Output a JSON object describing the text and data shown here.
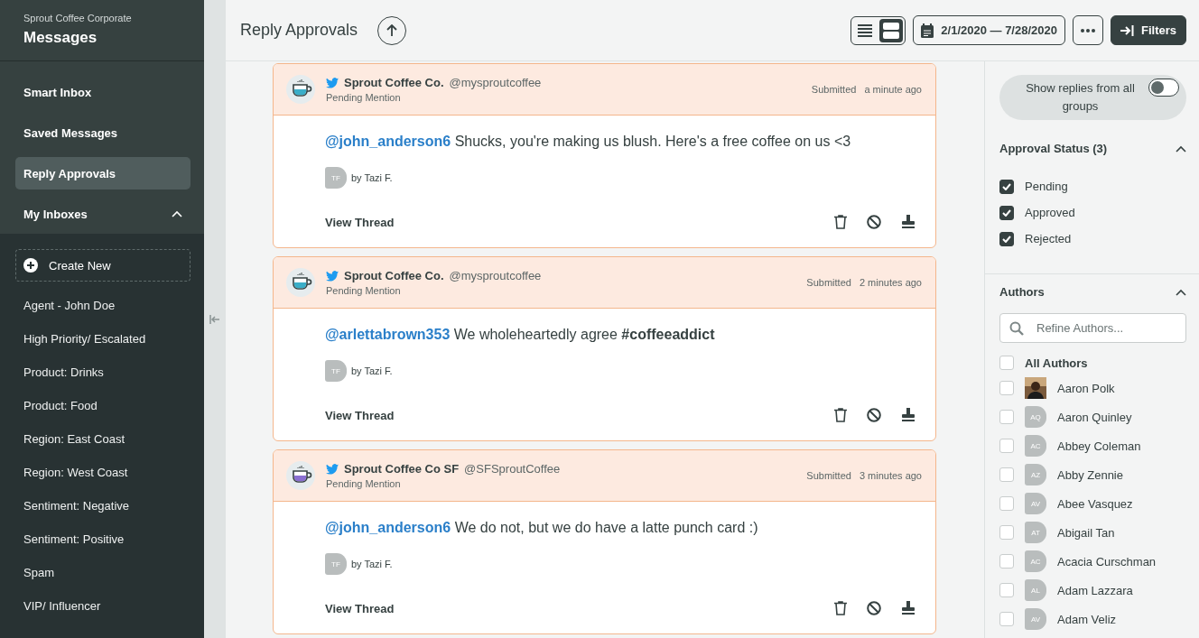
{
  "sidebar": {
    "org": "Sprout Coffee Corporate",
    "title": "Messages",
    "nav": [
      {
        "label": "Smart Inbox",
        "selected": false
      },
      {
        "label": "Saved Messages",
        "selected": false
      },
      {
        "label": "Reply Approvals",
        "selected": true
      }
    ],
    "my_inboxes": {
      "label": "My Inboxes",
      "expanded": true,
      "create_button": "Create New",
      "items": [
        "Agent - John Doe",
        "High Priority/ Escalated",
        "Product: Drinks",
        "Product: Food",
        "Region: East Coast",
        "Region: West Coast",
        "Sentiment: Negative",
        "Sentiment: Positive",
        "Spam",
        "VIP/ Influencer"
      ]
    }
  },
  "header": {
    "title": "Reply Approvals",
    "view_modes": [
      {
        "kind": "list",
        "selected": false
      },
      {
        "kind": "cards",
        "selected": true
      }
    ],
    "date_range": "2/1/2020 — 7/28/2020",
    "filters_button": "Filters"
  },
  "messages": [
    {
      "account": "Sprout Coffee Co.",
      "handle": "@mysproutcoffee",
      "status": "Pending Mention",
      "submitted_label": "Submitted",
      "time": "a minute ago",
      "color": "#3aaec8",
      "mention": "@john_anderson6",
      "text": "Shucks, you're making us blush. Here's a free coffee on us <3",
      "author_initials": "TF",
      "author": "by Tazi F.",
      "view_thread": "View Thread"
    },
    {
      "account": "Sprout Coffee Co.",
      "handle": "@mysproutcoffee",
      "status": "Pending Mention",
      "submitted_label": "Submitted",
      "time": "2 minutes ago",
      "color": "#3aaec8",
      "mention": "@arlettabrown353",
      "text": "We wholeheartedly agree **#coffeeaddict**",
      "author_initials": "TF",
      "author": "by Tazi F.",
      "view_thread": "View Thread"
    },
    {
      "account": "Sprout Coffee Co SF",
      "handle": "@SFSproutCoffee",
      "status": "Pending Mention",
      "submitted_label": "Submitted",
      "time": "3 minutes ago",
      "color": "#8a6fd1",
      "mention": "@john_anderson6",
      "text": "We do not, but we do have a latte punch card :)",
      "author_initials": "TF",
      "author": "by Tazi F.",
      "view_thread": "View Thread"
    }
  ],
  "filters": {
    "show_all_groups": {
      "label": "Show replies from all groups",
      "on": false
    },
    "approval_status": {
      "title": "Approval Status (3)",
      "expanded": true,
      "options": [
        {
          "label": "Pending",
          "checked": true
        },
        {
          "label": "Approved",
          "checked": true
        },
        {
          "label": "Rejected",
          "checked": true
        }
      ]
    },
    "authors": {
      "title": "Authors",
      "expanded": true,
      "placeholder": "Refine Authors...",
      "all": {
        "label": "All Authors",
        "checked": false
      },
      "items": [
        {
          "name": "Aaron Polk",
          "checked": false
        },
        {
          "name": "Aaron Quinley",
          "kind": "initials",
          "initials": "AQ",
          "checked": false
        },
        {
          "name": "Abbey Coleman",
          "kind": "initials",
          "initials": "AC",
          "checked": false
        },
        {
          "name": "Abby Zennie",
          "kind": "initials",
          "initials": "AZ",
          "checked": false
        },
        {
          "name": "Abee Vasquez",
          "kind": "initials",
          "initials": "AV",
          "checked": false
        },
        {
          "name": "Abigail Tan",
          "kind": "initials",
          "initials": "AT",
          "checked": false
        },
        {
          "name": "Acacia Curschman",
          "kind": "initials",
          "initials": "AC",
          "checked": false
        },
        {
          "name": "Adam Lazzara",
          "kind": "initials",
          "initials": "AL",
          "checked": false
        },
        {
          "name": "Adam Veliz",
          "kind": "initials",
          "initials": "AV",
          "checked": false
        }
      ]
    }
  }
}
